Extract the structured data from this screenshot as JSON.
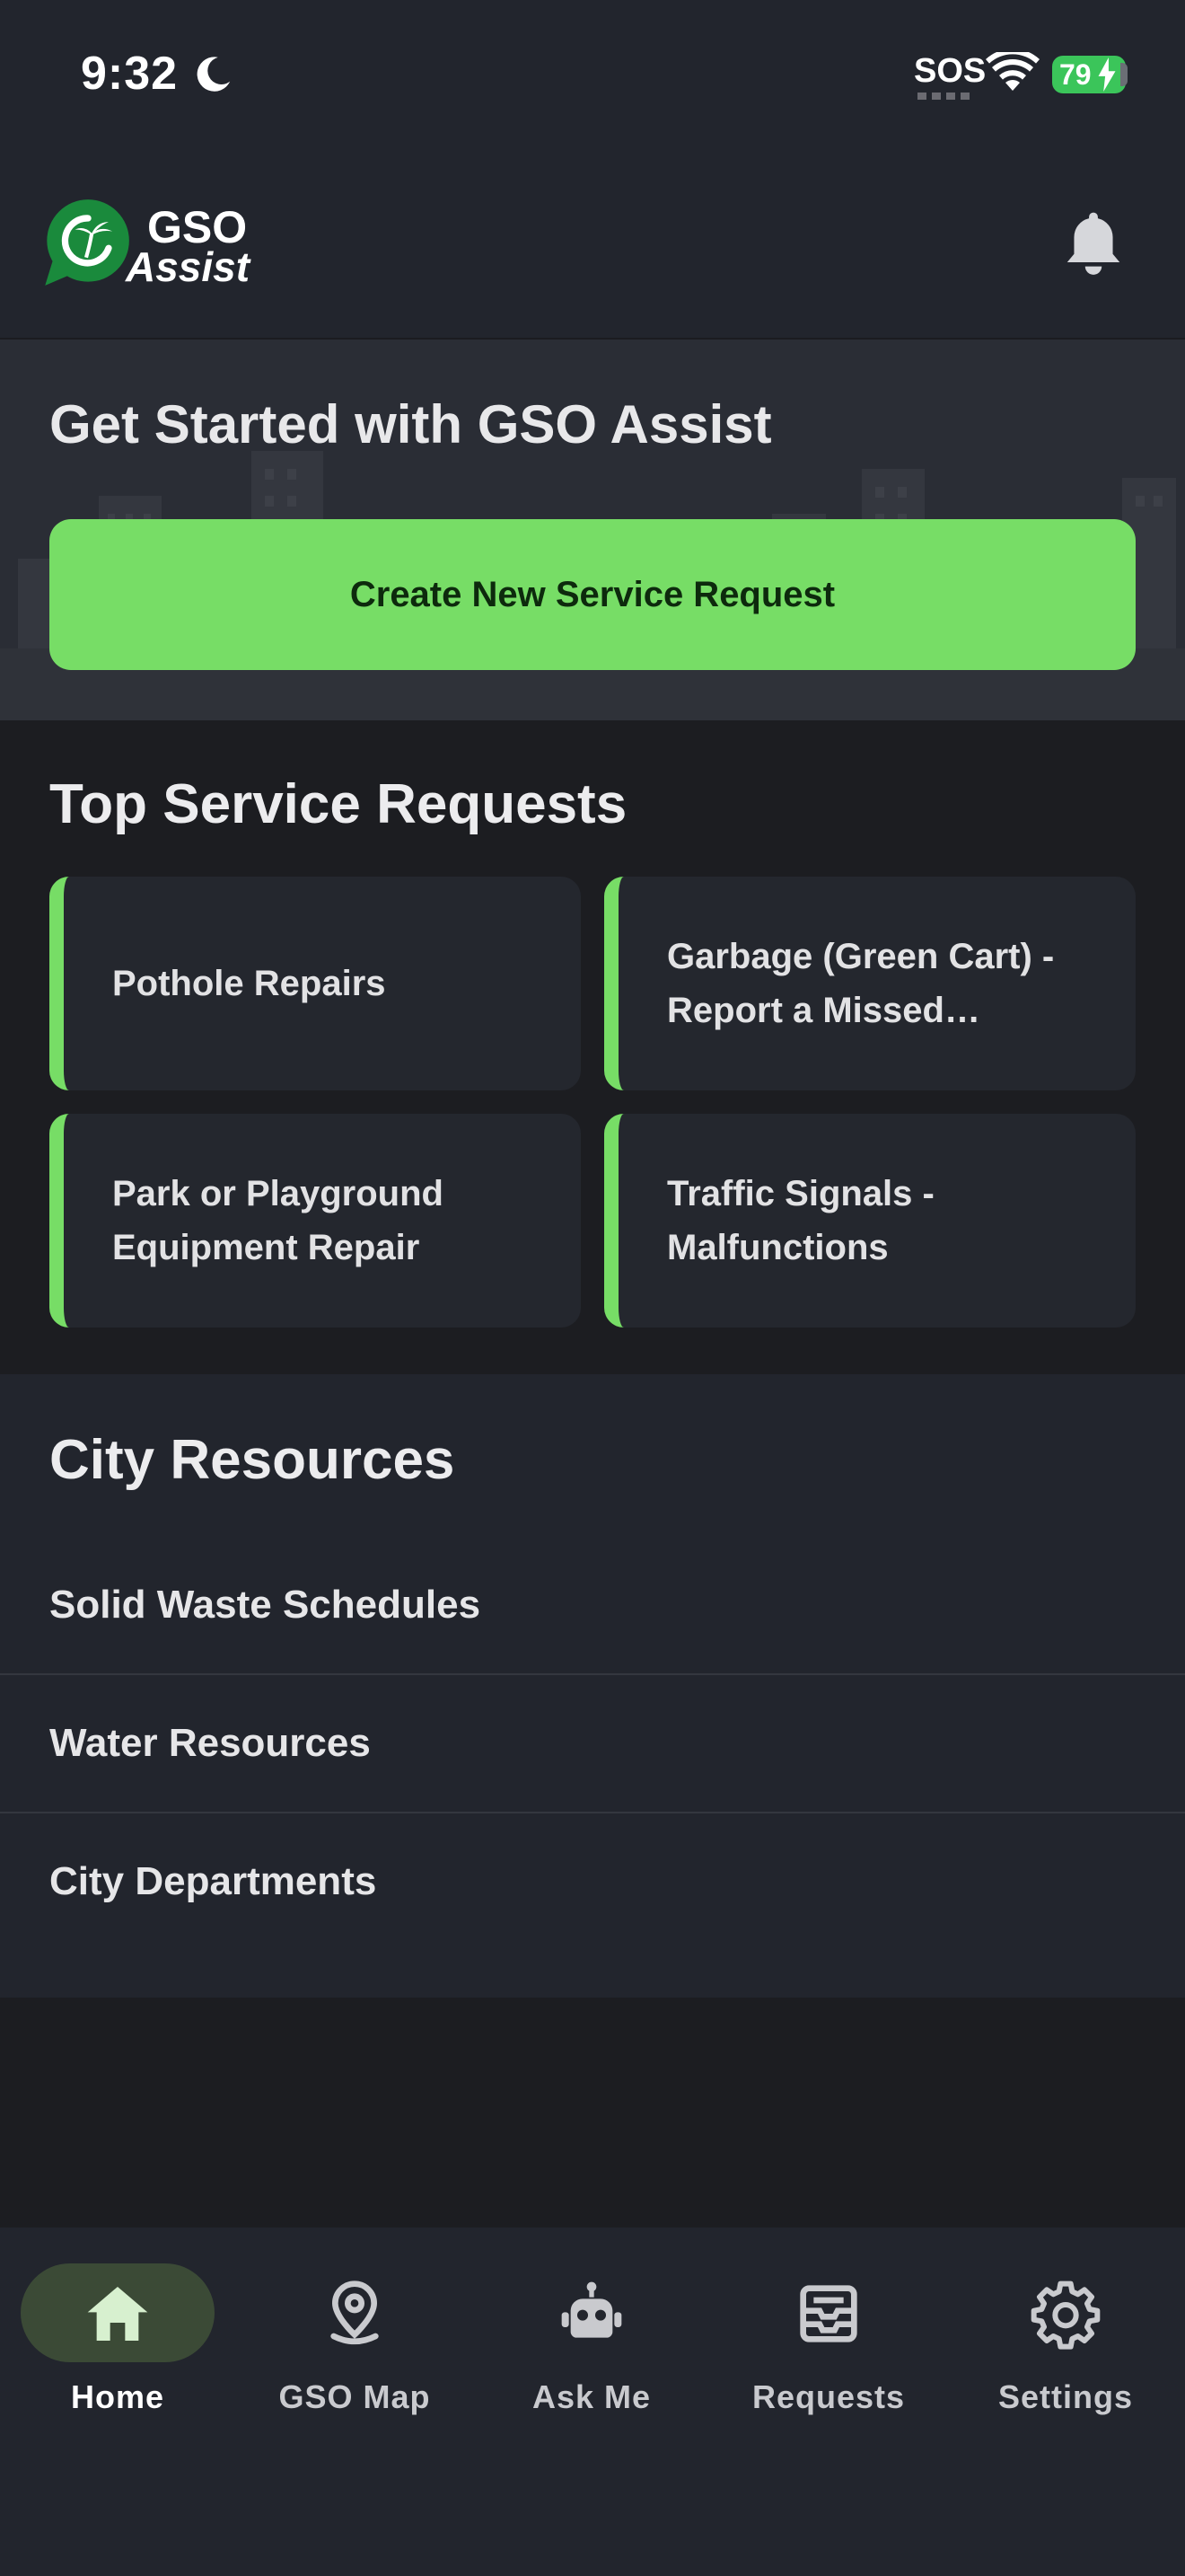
{
  "status_bar": {
    "time": "9:32",
    "carrier": "SOS",
    "battery": "79"
  },
  "header": {
    "logo_line1": "GSO",
    "logo_line2": "Assist",
    "logo_icon": "palm-tree-chat-bubble",
    "notification_icon": "bell-icon"
  },
  "hero": {
    "title": "Get Started with GSO Assist",
    "cta_label": "Create New Service Request"
  },
  "top_requests": {
    "title": "Top Service Requests",
    "items": [
      {
        "label": "Pothole Repairs"
      },
      {
        "label": "Garbage (Green Cart) - Report a Missed Collection"
      },
      {
        "label": "Park or Playground Equipment Repair"
      },
      {
        "label": "Traffic Signals - Malfunctions"
      }
    ]
  },
  "resources": {
    "title": "City Resources",
    "items": [
      {
        "label": "Solid Waste Schedules"
      },
      {
        "label": "Water Resources"
      },
      {
        "label": "City Departments"
      }
    ]
  },
  "nav": {
    "active": "Home",
    "items": [
      {
        "label": "Home",
        "icon": "home-icon"
      },
      {
        "label": "GSO Map",
        "icon": "map-pin-icon"
      },
      {
        "label": "Ask Me",
        "icon": "robot-icon"
      },
      {
        "label": "Requests",
        "icon": "inbox-icon"
      },
      {
        "label": "Settings",
        "icon": "gear-icon"
      }
    ]
  },
  "colors": {
    "accent": "#77dd66",
    "background": "#1c1d21",
    "surface": "#22252d",
    "card": "#24272e"
  }
}
